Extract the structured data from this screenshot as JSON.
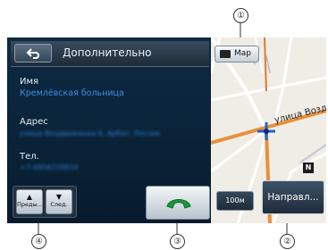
{
  "header": {
    "title": "Дополнительно"
  },
  "fields": [
    {
      "label": "Имя",
      "value": "Кремлёвская больница"
    },
    {
      "label": "Адрес",
      "value": "улица Воздвиженка 6, Арбат, Россия"
    },
    {
      "label": "Тел.",
      "value": "+7-4956228934"
    }
  ],
  "buttons": {
    "prev": "Преды...",
    "next": "След.",
    "map": "Map",
    "route": "Направл...",
    "scale": "100м"
  },
  "map": {
    "street": "улица Воздвиженка",
    "north_badge": "N"
  },
  "callouts": [
    "①",
    "②",
    "③",
    "④"
  ]
}
